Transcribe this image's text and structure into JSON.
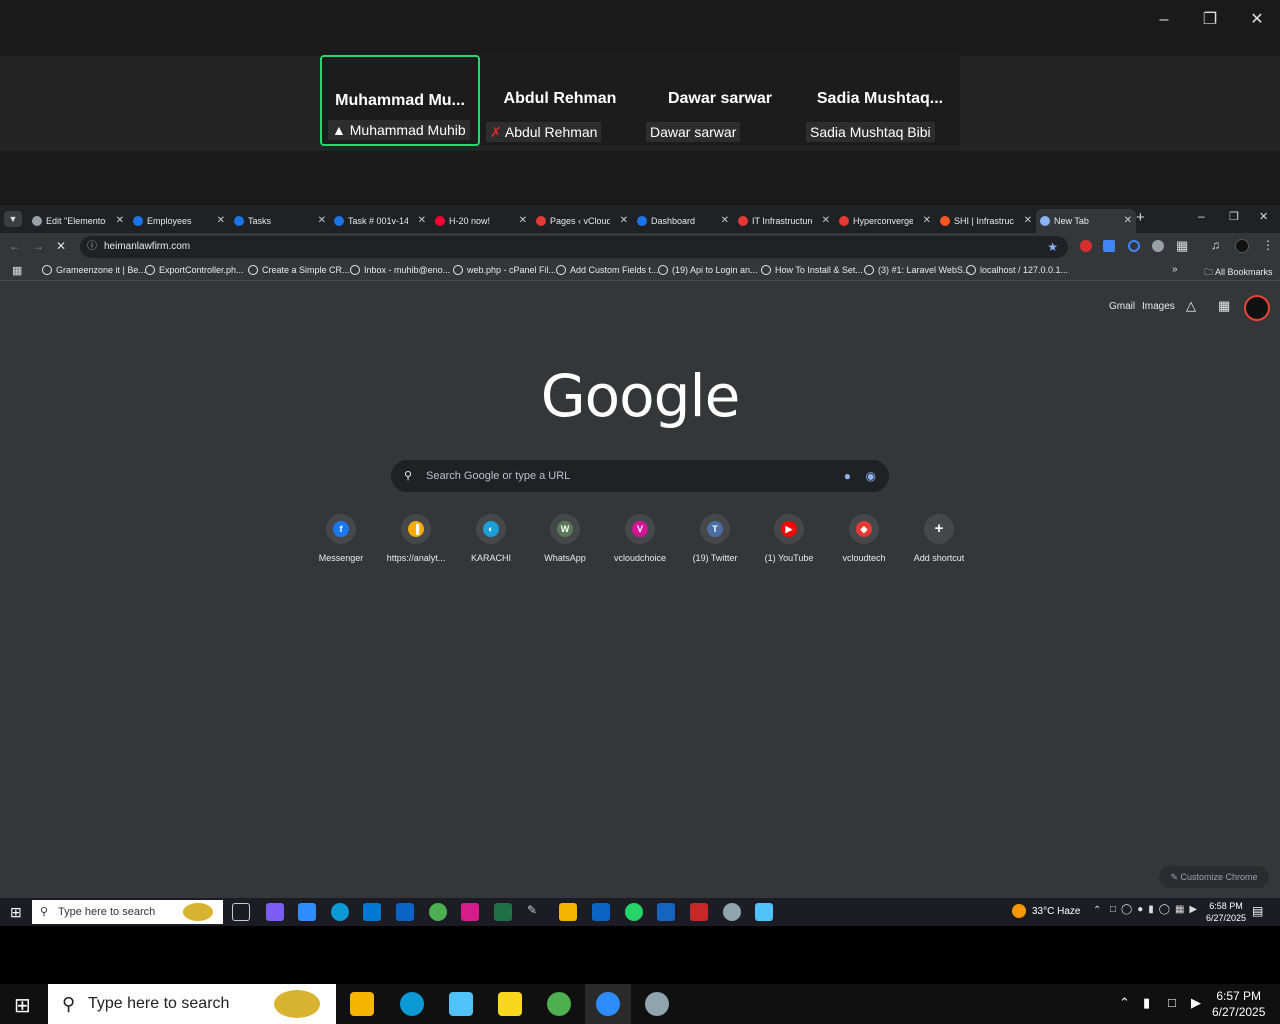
{
  "zoom": {
    "participants": [
      {
        "display_name": "Muhammad  Mu...",
        "label": "Muhammad Muhib",
        "label_icon": "pin-icon",
        "active": true
      },
      {
        "display_name": "Abdul Rehman",
        "label": "Abdul Rehman",
        "label_icon": "mic-muted-icon",
        "active": false
      },
      {
        "display_name": "Dawar sarwar",
        "label": "Dawar sarwar",
        "label_icon": "",
        "active": false
      },
      {
        "display_name": "Sadia  Mushtaq...",
        "label": "Sadia Mushtaq Bibi",
        "label_icon": "",
        "active": false
      }
    ],
    "active_border_color": "#23d96b"
  },
  "chrome": {
    "tabs": [
      {
        "title": "Edit \"Elementor",
        "favicon_color": "#9aa0a6"
      },
      {
        "title": "Employees",
        "favicon_color": "#1a73e8"
      },
      {
        "title": "Tasks",
        "favicon_color": "#1a73e8"
      },
      {
        "title": "Task # 001v-14",
        "favicon_color": "#1a73e8"
      },
      {
        "title": "H-20 now!",
        "favicon_color": "#ff0033"
      },
      {
        "title": "Pages ‹ vCloud",
        "favicon_color": "#e53935"
      },
      {
        "title": "Dashboard",
        "favicon_color": "#1a73e8"
      },
      {
        "title": "IT Infrastructure",
        "favicon_color": "#e53935"
      },
      {
        "title": "Hyperconverge",
        "favicon_color": "#e53935"
      },
      {
        "title": "SHI | Infrastruc",
        "favicon_color": "#ff5722"
      },
      {
        "title": "New Tab",
        "favicon_color": "#8ab4f8"
      }
    ],
    "address": "heimanlawfirm.com",
    "bookmarks": [
      "Grameenzone it | Be...",
      "ExportController.ph...",
      "Create a Simple CR...",
      "Inbox - muhib@eno...",
      "web.php - cPanel Fil...",
      "Add Custom Fields t...",
      "(19) Api to Login an...",
      "How To Install & Set...",
      "(3) #1: Laravel WebS...",
      "localhost / 127.0.0.1..."
    ],
    "all_bookmarks": "All Bookmarks",
    "ntp": {
      "top_links": [
        "Gmail",
        "Images"
      ],
      "logo": "Google",
      "search_placeholder": "Search Google or type a URL",
      "shortcuts": [
        {
          "label": "Messenger",
          "glyph": "f",
          "color": "#1877f2"
        },
        {
          "label": "https://analyt...",
          "glyph": "▐",
          "color": "#f9ab00"
        },
        {
          "label": "KARACHI",
          "glyph": "◐",
          "color": "#1a9fd6"
        },
        {
          "label": "WhatsApp",
          "glyph": "W",
          "color": "#5b7a5a"
        },
        {
          "label": "vcloudchoice",
          "glyph": "V",
          "color": "#d31396"
        },
        {
          "label": "(19) Twitter",
          "glyph": "T",
          "color": "#4a6fa5"
        },
        {
          "label": "(1) YouTube",
          "glyph": "▶",
          "color": "#ff0000"
        },
        {
          "label": "vcloudtech",
          "glyph": "◆",
          "color": "#e53935"
        },
        {
          "label": "Add shortcut",
          "glyph": "+",
          "color": "transparent"
        }
      ],
      "customize": "Customize Chrome"
    }
  },
  "inner_taskbar": {
    "search_placeholder": "Type here to search",
    "weather": "33°C  Haze",
    "time": "6:58 PM",
    "date": "6/27/2025"
  },
  "taskbar": {
    "search_placeholder": "Type here to search",
    "time": "6:57 PM",
    "date": "6/27/2025"
  }
}
